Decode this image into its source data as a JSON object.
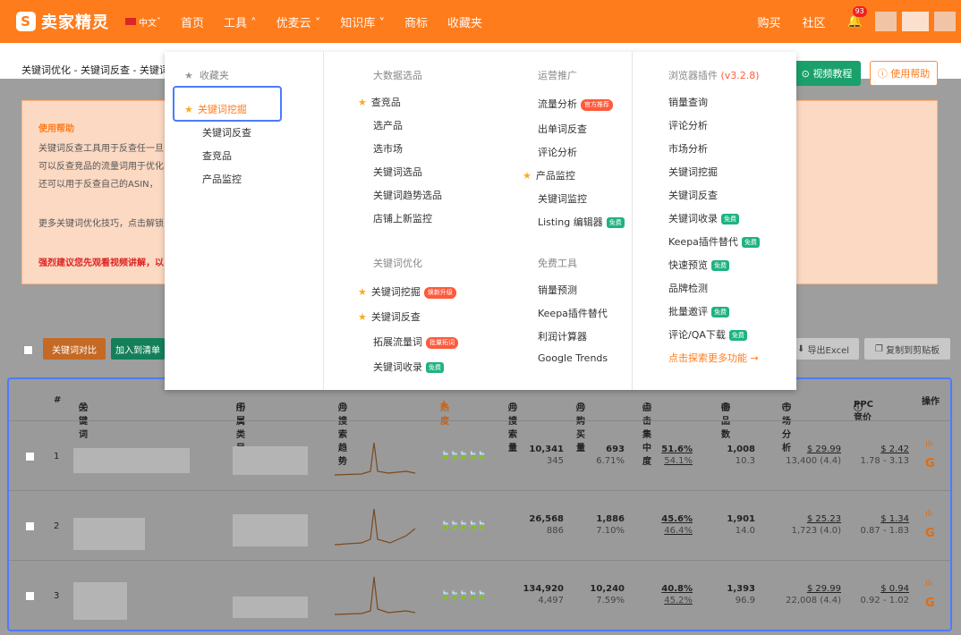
{
  "topbar": {
    "logo_text": "卖家精灵",
    "lang": "中文",
    "nav": [
      "首页",
      "工具",
      "优麦云",
      "知识库",
      "商标",
      "收藏夹"
    ],
    "nav_right": [
      "购买",
      "社区"
    ],
    "notif_count": "93",
    "brand_color": "#ff7c1c"
  },
  "breadcrumb": "关键词优化 - 关键词反查 - 关键词",
  "video_btn": "视频教程",
  "help_btn": "使用帮助",
  "help_panel": {
    "title": "使用帮助",
    "lines": [
      "关键词反查工具用于反查任一旦",
      "可以反查竞品的流量词用于优化",
      "还可以用于反查自己的ASIN，",
      "更多关键词优化技巧，点击解锁",
      "强烈建议您先观看视频讲解，以"
    ]
  },
  "actions": {
    "compare": "关键词对比",
    "add_list": "加入到清单",
    "export": "导出Excel",
    "copy": "复制到剪贴板"
  },
  "table": {
    "headers": [
      "#",
      "关键词",
      "所属类目",
      "月搜索趋势",
      "热度",
      "月搜索量",
      "月购买量",
      "点击集中度",
      "商品数",
      "市场分析",
      "PPC竞价",
      "操作"
    ],
    "rows": [
      {
        "idx": "1",
        "search": "10,341",
        "search_sub": "345",
        "buy": "693",
        "buy_sub": "6.71%",
        "click": "51.6%",
        "click_sub": "54.1%",
        "products": "1,008",
        "products_sub": "10.3",
        "market": "$ 29.99",
        "market_sub": "13,400 (4.4)",
        "ppc": "$ 2.42",
        "ppc_sub": "1.78 - 3.13"
      },
      {
        "idx": "2",
        "search": "26,568",
        "search_sub": "886",
        "buy": "1,886",
        "buy_sub": "7.10%",
        "click": "45.6%",
        "click_sub": "46.4%",
        "products": "1,901",
        "products_sub": "14.0",
        "market": "$ 25.23",
        "market_sub": "1,723 (4.0)",
        "ppc": "$ 1.34",
        "ppc_sub": "0.87 - 1.83"
      },
      {
        "idx": "3",
        "search": "134,920",
        "search_sub": "4,497",
        "buy": "10,240",
        "buy_sub": "7.59%",
        "click": "40.8%",
        "click_sub": "45.2%",
        "products": "1,393",
        "products_sub": "96.9",
        "market": "$ 29.99",
        "market_sub": "22,008 (4.4)",
        "ppc": "$ 0.94",
        "ppc_sub": "0.92 - 1.02"
      }
    ]
  },
  "dropdown": {
    "fav_title": "收藏夹",
    "fav_items": [
      "关键词挖掘",
      "关键词反查",
      "查竞品",
      "产品监控"
    ],
    "bigdata_title": "大数据选品",
    "bigdata_items": [
      "查竞品",
      "选产品",
      "选市场",
      "关键词选品",
      "关键词趋势选品",
      "店铺上新监控"
    ],
    "kw_title": "关键词优化",
    "kw_items": [
      "关键词挖掘",
      "关键词反查",
      "拓展流量词",
      "关键词收录"
    ],
    "kw_badges": [
      "焕新升级",
      "",
      "批量拓词",
      "免费"
    ],
    "ops_title": "运营推广",
    "ops_items": [
      "流量分析",
      "出单词反查",
      "评论分析",
      "产品监控",
      "关键词监控",
      "Listing 编辑器"
    ],
    "ops_badges": [
      "官方推荐",
      "",
      "",
      "",
      "",
      "免费"
    ],
    "free_title": "免费工具",
    "free_items": [
      "销量预测",
      "Keepa插件替代",
      "利润计算器",
      "Google Trends"
    ],
    "plugin_title": "浏览器插件",
    "plugin_version": "(v3.2.8)",
    "plugin_items": [
      "销量查询",
      "评论分析",
      "市场分析",
      "关键词挖掘",
      "关键词反查",
      "关键词收录",
      "Keepa插件替代",
      "快速预览",
      "品牌检测",
      "批量邀评",
      "评论/QA下载"
    ],
    "plugin_badges": [
      "",
      "",
      "",
      "",
      "",
      "免费",
      "免费",
      "免费",
      "",
      "免费",
      "免费"
    ],
    "more_link": "点击探索更多功能 →"
  }
}
